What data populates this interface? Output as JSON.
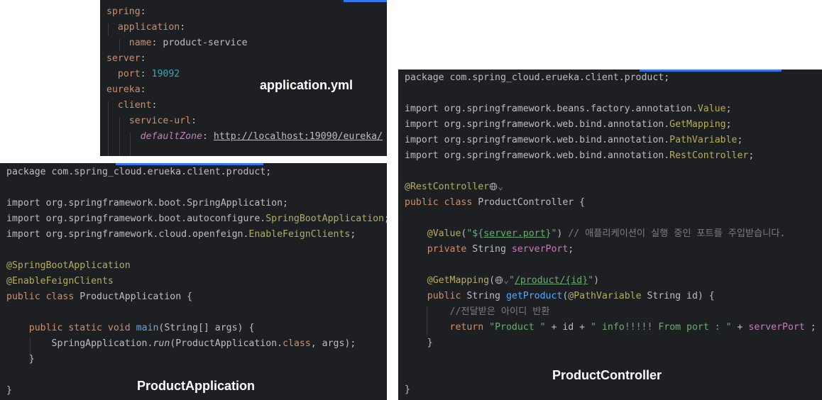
{
  "yaml_panel": {
    "label": "application.yml",
    "lines": [
      [
        {
          "t": "spring",
          "c": "t-yamlkey"
        },
        {
          "t": ":",
          "c": "t-plain"
        }
      ],
      [
        {
          "t": "  application",
          "c": "t-yamlkey"
        },
        {
          "t": ":",
          "c": "t-plain"
        }
      ],
      [
        {
          "t": "    name",
          "c": "t-yamlkey"
        },
        {
          "t": ": product-service",
          "c": "t-plain"
        }
      ],
      [
        {
          "t": "server",
          "c": "t-yamlkey"
        },
        {
          "t": ":",
          "c": "t-plain"
        }
      ],
      [
        {
          "t": "  port",
          "c": "t-yamlkey"
        },
        {
          "t": ": ",
          "c": "t-plain"
        },
        {
          "t": "19092",
          "c": "t-num"
        }
      ],
      [
        {
          "t": "eureka",
          "c": "t-yamlkey"
        },
        {
          "t": ":",
          "c": "t-plain"
        }
      ],
      [
        {
          "t": "  client",
          "c": "t-yamlkey"
        },
        {
          "t": ":",
          "c": "t-plain"
        }
      ],
      [
        {
          "t": "    service-url",
          "c": "t-yamlkey"
        },
        {
          "t": ":",
          "c": "t-plain"
        }
      ],
      [
        {
          "t": "      ",
          "c": "t-plain"
        },
        {
          "t": "defaultZone",
          "c": "t-italic"
        },
        {
          "t": ": ",
          "c": "t-plain"
        },
        {
          "t": "http://localhost:19090/eureka/",
          "c": "t-link"
        }
      ]
    ]
  },
  "app_panel": {
    "label": "ProductApplication",
    "lines": [
      [
        {
          "t": "package com.spring_cloud.erueka.client.product;",
          "c": "t-plain"
        }
      ],
      [],
      [
        {
          "t": "import org.springframework.boot.SpringApplication;",
          "c": "t-plain"
        }
      ],
      [
        {
          "t": "import org.springframework.boot.autoconfigure.",
          "c": "t-plain"
        },
        {
          "t": "SpringBootApplication",
          "c": "t-hl"
        },
        {
          "t": ";",
          "c": "t-plain"
        }
      ],
      [
        {
          "t": "import org.springframework.cloud.openfeign.",
          "c": "t-plain"
        },
        {
          "t": "EnableFeignClients",
          "c": "t-hl"
        },
        {
          "t": ";",
          "c": "t-plain"
        }
      ],
      [],
      [
        {
          "t": "@SpringBootApplication",
          "c": "t-ann"
        }
      ],
      [
        {
          "t": "@EnableFeignClients",
          "c": "t-ann"
        }
      ],
      [
        {
          "t": "public class",
          "c": "t-key"
        },
        {
          "t": " ProductApplication {",
          "c": "t-plain"
        }
      ],
      [],
      [
        {
          "t": "    ",
          "c": "t-plain"
        },
        {
          "t": "public static void",
          "c": "t-key"
        },
        {
          "t": " ",
          "c": "t-plain"
        },
        {
          "t": "main",
          "c": "t-fn"
        },
        {
          "t": "(String[] args) {",
          "c": "t-plain"
        }
      ],
      [
        {
          "t": "        SpringApplication.",
          "c": "t-plain"
        },
        {
          "t": "run",
          "c": "t-ital2"
        },
        {
          "t": "(ProductApplication.",
          "c": "t-plain"
        },
        {
          "t": "class",
          "c": "t-key"
        },
        {
          "t": ", args);",
          "c": "t-plain"
        }
      ],
      [
        {
          "t": "    }",
          "c": "t-plain"
        }
      ],
      [],
      [
        {
          "t": "}",
          "c": "t-plain"
        }
      ]
    ]
  },
  "ctrl_panel": {
    "label": "ProductController",
    "lines": [
      [
        {
          "t": "package com.spring_cloud.erueka.client.product;",
          "c": "t-plain"
        }
      ],
      [],
      [
        {
          "t": "import org.springframework.beans.factory.annotation.",
          "c": "t-plain"
        },
        {
          "t": "Value",
          "c": "t-hl"
        },
        {
          "t": ";",
          "c": "t-plain"
        }
      ],
      [
        {
          "t": "import org.springframework.web.bind.annotation.",
          "c": "t-plain"
        },
        {
          "t": "GetMapping",
          "c": "t-hl"
        },
        {
          "t": ";",
          "c": "t-plain"
        }
      ],
      [
        {
          "t": "import org.springframework.web.bind.annotation.",
          "c": "t-plain"
        },
        {
          "t": "PathVariable",
          "c": "t-hl"
        },
        {
          "t": ";",
          "c": "t-plain"
        }
      ],
      [
        {
          "t": "import org.springframework.web.bind.annotation.",
          "c": "t-plain"
        },
        {
          "t": "RestController",
          "c": "t-hl"
        },
        {
          "t": ";",
          "c": "t-plain"
        }
      ],
      [],
      [
        {
          "t": "@RestController",
          "c": "t-ann"
        },
        {
          "icon": "globe-icon"
        },
        {
          "t": "⌄",
          "c": "t-cmt"
        }
      ],
      [
        {
          "t": "public class",
          "c": "t-key"
        },
        {
          "t": " ProductController {",
          "c": "t-plain"
        }
      ],
      [],
      [
        {
          "t": "    ",
          "c": "t-plain"
        },
        {
          "t": "@Value",
          "c": "t-ann"
        },
        {
          "t": "(",
          "c": "t-plain"
        },
        {
          "t": "\"${",
          "c": "t-str"
        },
        {
          "t": "server.port",
          "c": "t-slink"
        },
        {
          "t": "}\"",
          "c": "t-str"
        },
        {
          "t": ") ",
          "c": "t-plain"
        },
        {
          "t": "// 애플리케이션이 실행 중인 포트를 주입받습니다.",
          "c": "t-cmt"
        }
      ],
      [
        {
          "t": "    ",
          "c": "t-plain"
        },
        {
          "t": "private",
          "c": "t-key"
        },
        {
          "t": " String ",
          "c": "t-plain"
        },
        {
          "t": "serverPort",
          "c": "t-field"
        },
        {
          "t": ";",
          "c": "t-plain"
        }
      ],
      [],
      [
        {
          "t": "    ",
          "c": "t-plain"
        },
        {
          "t": "@GetMapping",
          "c": "t-ann"
        },
        {
          "t": "(",
          "c": "t-plain"
        },
        {
          "icon": "globe-icon"
        },
        {
          "t": "⌄",
          "c": "t-cmt"
        },
        {
          "t": "\"",
          "c": "t-str"
        },
        {
          "t": "/product/{id}",
          "c": "t-slink"
        },
        {
          "t": "\"",
          "c": "t-str"
        },
        {
          "t": ")",
          "c": "t-plain"
        }
      ],
      [
        {
          "t": "    ",
          "c": "t-plain"
        },
        {
          "t": "public",
          "c": "t-key"
        },
        {
          "t": " String ",
          "c": "t-plain"
        },
        {
          "t": "getProduct",
          "c": "t-fn"
        },
        {
          "t": "(",
          "c": "t-plain"
        },
        {
          "t": "@PathVariable",
          "c": "t-ann"
        },
        {
          "t": " String id) {",
          "c": "t-plain"
        }
      ],
      [
        {
          "t": "        ",
          "c": "t-plain"
        },
        {
          "t": "//전달받은 아이디 반환",
          "c": "t-cmt"
        }
      ],
      [
        {
          "t": "        ",
          "c": "t-plain"
        },
        {
          "t": "return",
          "c": "t-key"
        },
        {
          "t": " ",
          "c": "t-plain"
        },
        {
          "t": "\"Product \"",
          "c": "t-str"
        },
        {
          "t": " + id + ",
          "c": "t-plain"
        },
        {
          "t": "\" info!!!!! From port : \"",
          "c": "t-str"
        },
        {
          "t": " + ",
          "c": "t-plain"
        },
        {
          "t": "serverPort",
          "c": "t-field"
        },
        {
          "t": " ;",
          "c": "t-plain"
        }
      ],
      [
        {
          "t": "    }",
          "c": "t-plain"
        }
      ],
      [],
      [],
      [
        {
          "t": "}",
          "c": "t-plain"
        }
      ]
    ]
  }
}
